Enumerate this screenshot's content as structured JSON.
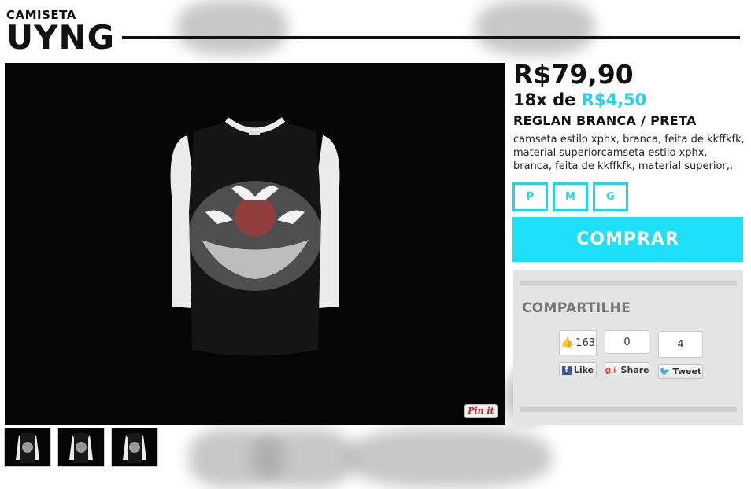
{
  "header": {
    "category": "CAMISETA",
    "title": "UYNG"
  },
  "product": {
    "price": "R$79,90",
    "installment_prefix": "18x de",
    "installment_value": "R$4,50",
    "name": "REGLAN BRANCA / PRETA",
    "description": "camseta estilo xphx, branca, feita de kkffkfk, material superiorcamseta estilo xphx, branca, feita de kkffkfk, material superior,,",
    "image_alt": "raglan t-shirt black body white sleeves with dove print"
  },
  "sizes": [
    "P",
    "M",
    "G"
  ],
  "buy_label": "COMPRAR",
  "pin_label": "Pin it",
  "share": {
    "title": "COMPARTILHE",
    "facebook": {
      "count": "163",
      "label": "Like"
    },
    "google": {
      "count": "0",
      "label": "Share"
    },
    "twitter": {
      "count": "4",
      "label": "Tweet"
    }
  },
  "colors": {
    "accent": "#22d3f0",
    "button": "#1ee0fb",
    "share_bg": "#e4e4e4"
  },
  "icons": [
    "thumbs-up-icon",
    "facebook-icon",
    "google-plus-icon",
    "twitter-icon",
    "pinterest-icon"
  ]
}
